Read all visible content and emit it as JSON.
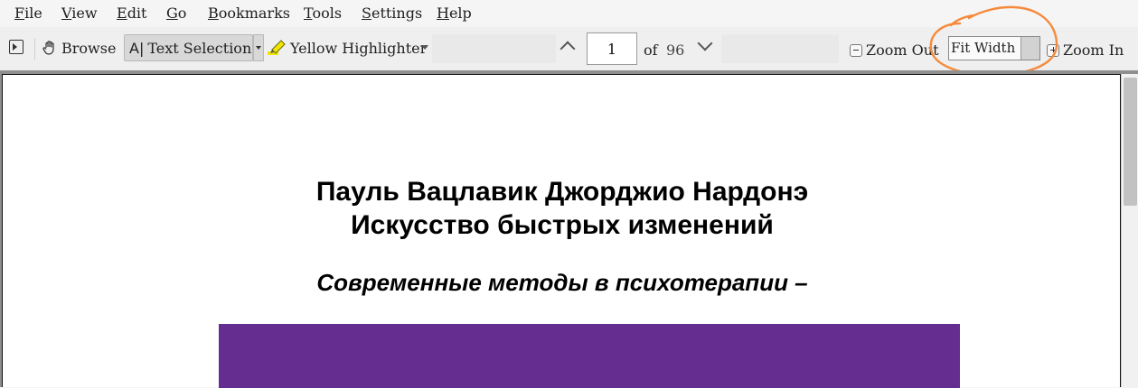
{
  "menu": {
    "items": [
      {
        "mn": "F",
        "rest": "ile"
      },
      {
        "mn": "V",
        "rest": "iew"
      },
      {
        "mn": "E",
        "rest": "dit"
      },
      {
        "mn": "G",
        "rest": "o"
      },
      {
        "mn": "B",
        "rest": "ookmarks"
      },
      {
        "mn": "T",
        "rest": "ools"
      },
      {
        "mn": "S",
        "rest": "ettings"
      },
      {
        "mn": "H",
        "rest": "elp"
      }
    ]
  },
  "toolbar": {
    "browse_label": "Browse",
    "text_selection_label": "Text Selection",
    "highlighter_label": "Yellow Highlighter",
    "page_value": "1",
    "of_label": "of",
    "total_pages": "96",
    "zoom_out_label": "Zoom Out",
    "zoom_mode": "Fit Width",
    "zoom_in_label": "Zoom In"
  },
  "document": {
    "title_line1": "Пауль Вацлавик Джорджио Нардонэ",
    "title_line2": "Искусство быстрых изменений",
    "subtitle": "Современные методы в психотерапии –",
    "cover_color": "#662d91"
  },
  "colors": {
    "highlighter": "#f2e600",
    "annotation": "#f58a3c"
  }
}
